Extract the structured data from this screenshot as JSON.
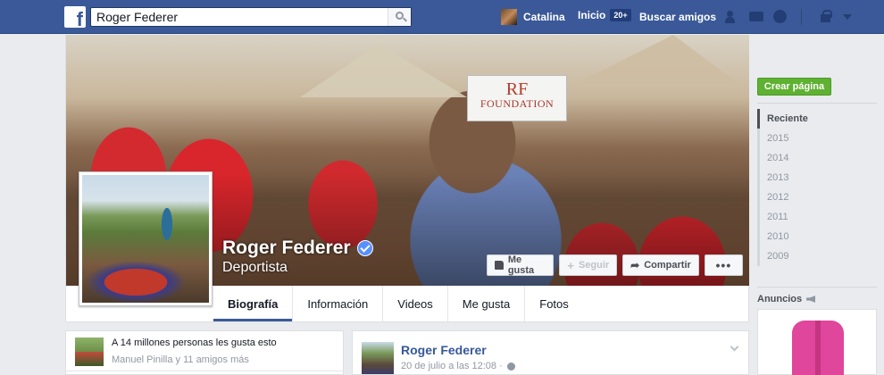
{
  "topbar": {
    "logo_letter": "f",
    "search_value": "Roger Federer",
    "user_name": "Catalina",
    "home_label": "Inicio",
    "home_badge": "20+",
    "find_friends_label": "Buscar amigos"
  },
  "cover": {
    "banner_logo": "RF",
    "banner_text": "FOUNDATION"
  },
  "profile": {
    "name": "Roger Federer",
    "category": "Deportista",
    "verified": true
  },
  "actions": {
    "like_label": "Me gusta",
    "follow_label": "Seguir",
    "share_label": "Compartir",
    "more_label": "•••"
  },
  "tabs": [
    {
      "label": "Biografía",
      "active": true
    },
    {
      "label": "Información"
    },
    {
      "label": "Videos"
    },
    {
      "label": "Me gusta"
    },
    {
      "label": "Fotos"
    }
  ],
  "sidebar": {
    "create_page_label": "Crear página",
    "years": [
      "Reciente",
      "2015",
      "2014",
      "2013",
      "2012",
      "2011",
      "2010",
      "2009"
    ],
    "ads_label": "Anuncios"
  },
  "likes": {
    "count_text": "A 14 millones personas les gusta esto",
    "friends_text": "Manuel Pinilla y 11 amigos más"
  },
  "post": {
    "author": "Roger Federer",
    "timestamp": "20 de julio a las 12:08 ·"
  },
  "colors": {
    "brand_blue": "#3b5998",
    "create_page_green": "#5fb132",
    "verified_blue": "#5890ff"
  }
}
